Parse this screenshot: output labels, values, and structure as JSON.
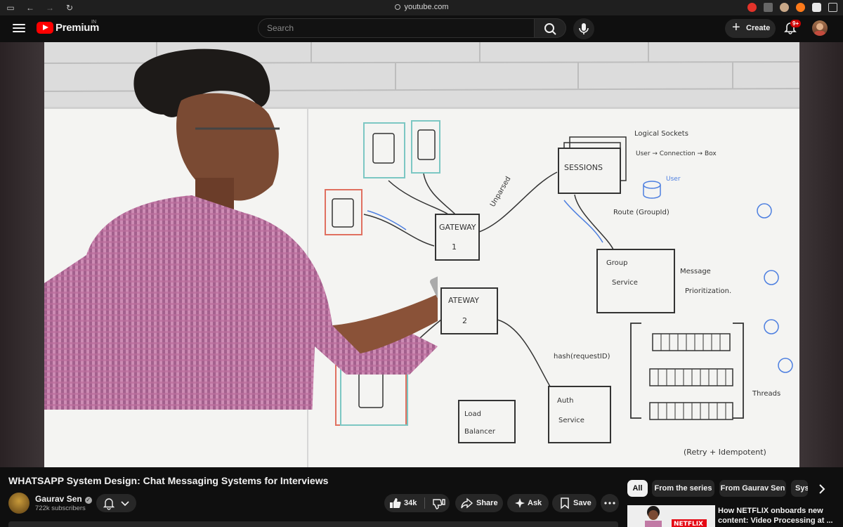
{
  "browser": {
    "url": "youtube.com"
  },
  "header": {
    "logo_text": "Premium",
    "logo_country": "IN",
    "search_placeholder": "Search",
    "create_label": "Create",
    "notification_badge": "9+"
  },
  "video": {
    "title": "WHATSAPP System Design: Chat Messaging Systems for Interviews",
    "whiteboard_text": {
      "sessions": "SESSIONS",
      "logical_sockets": "Logical Sockets",
      "user_conn_box": "User → Connection → Box",
      "unparsed": "Unparsed",
      "gateway1": "GATEWAY",
      "gateway1_num": "1",
      "gateway2": "ATEWAY",
      "gateway2_num": "2",
      "route": "Route (GroupId)",
      "group_service_1": "Group",
      "group_service_2": "Service",
      "message_prior_1": "Message",
      "message_prior_2": "Prioritization.",
      "hash": "hash(requestID)",
      "threads": "Threads",
      "auth_1": "Auth",
      "auth_2": "Service",
      "lb_1": "Load",
      "lb_2": "Balancer",
      "retry": "(Retry + Idempotent)",
      "user": "User"
    }
  },
  "channel": {
    "name": "Gaurav Sen",
    "subscribers": "722k subscribers"
  },
  "actions": {
    "likes": "34k",
    "share": "Share",
    "ask": "Ask",
    "save": "Save"
  },
  "chips": [
    "All",
    "From the series",
    "From Gaurav Sen",
    "Sys"
  ],
  "related": {
    "title": "How NETFLIX onboards new content: Video Processing at ...",
    "thumb_text": "NETFLIX"
  },
  "colors": {
    "background": "#0f0f0f",
    "youtube_red": "#ff0000",
    "pill": "#272727"
  }
}
